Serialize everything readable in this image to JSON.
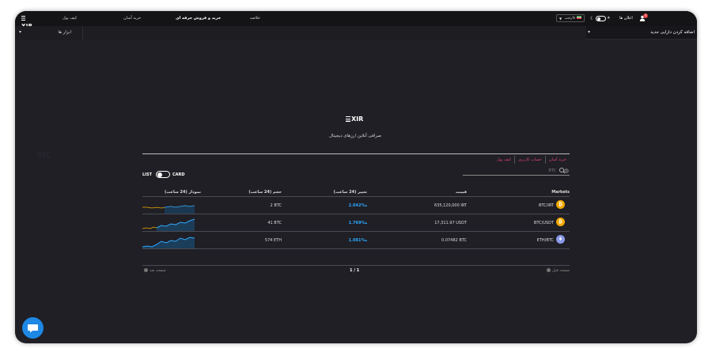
{
  "brand": {
    "logo_text": "XIR"
  },
  "topbar": {
    "nav": [
      {
        "label": "کیف پول"
      },
      {
        "label": "خرید آسان"
      },
      {
        "label": "خرید و فروش حرفه ای"
      },
      {
        "label": "خلاصه"
      }
    ],
    "language": {
      "selected": "فارسی"
    },
    "notifications": {
      "label": "اعلان ها",
      "count": "4"
    }
  },
  "subbar": {
    "tools_label": "ابزار ها",
    "add_asset_label": "اضافه کردن دارایی جدید"
  },
  "background_text": "BTC",
  "hero": {
    "tagline": "صرافی آنلاین ارزهای دیجیتال"
  },
  "quick_links": [
    {
      "label": "خرید آسان"
    },
    {
      "label": "حساب کاربری"
    },
    {
      "label": "کیف پول"
    }
  ],
  "view_toggle": {
    "left": "LIST",
    "right": "CARD"
  },
  "search": {
    "placeholder": "BTC"
  },
  "table": {
    "headers": {
      "markets": "Markets",
      "price": "قیمت",
      "change": "تغییر (24 ساعت)",
      "volume": "حجم (24 ساعت)",
      "chart": "نمودار (24 ساعت)"
    },
    "rows": [
      {
        "market": "BTC/IRT",
        "price": "635,120,000 IRT",
        "change": "2.042%",
        "volume": "2 BTC",
        "coin": "₿",
        "coin_color": "#f2a900"
      },
      {
        "market": "BTC/USDT",
        "price": "17,311.97 USDT",
        "change": "1.769%",
        "volume": "41 BTC",
        "coin": "₿",
        "coin_color": "#f2a900"
      },
      {
        "market": "ETH/BTC",
        "price": "0.07482 BTC",
        "change": "1.081%",
        "volume": "574 ETH",
        "coin": "♦",
        "coin_color": "#8a9ae8"
      }
    ]
  },
  "pager": {
    "prev": "صفحه قبل",
    "page": "1 / 1",
    "next": "صفحه بعد"
  },
  "colors": {
    "accent_pink": "#e0407a",
    "accent_blue": "#2ea8ff",
    "chat_blue": "#1e88e5"
  }
}
